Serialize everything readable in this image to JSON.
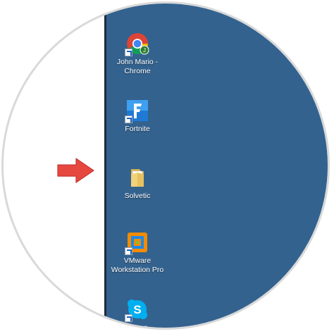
{
  "desktop": {
    "background_color": "#33628f",
    "icons": [
      {
        "label_line1": "John Mario -",
        "label_line2": "Chrome",
        "icon": "chrome-icon"
      },
      {
        "label_line1": "Fortnite",
        "icon": "fortnite-icon"
      },
      {
        "label_line1": "Solvetic",
        "icon": "folder-icon"
      },
      {
        "label_line1": "VMware",
        "label_line2": "Workstation Pro",
        "icon": "vmware-icon"
      },
      {
        "label_line1": "Skype",
        "icon": "skype-icon"
      }
    ]
  },
  "annotation": {
    "arrow_color": "#e64840",
    "icon": "red-arrow-icon"
  }
}
